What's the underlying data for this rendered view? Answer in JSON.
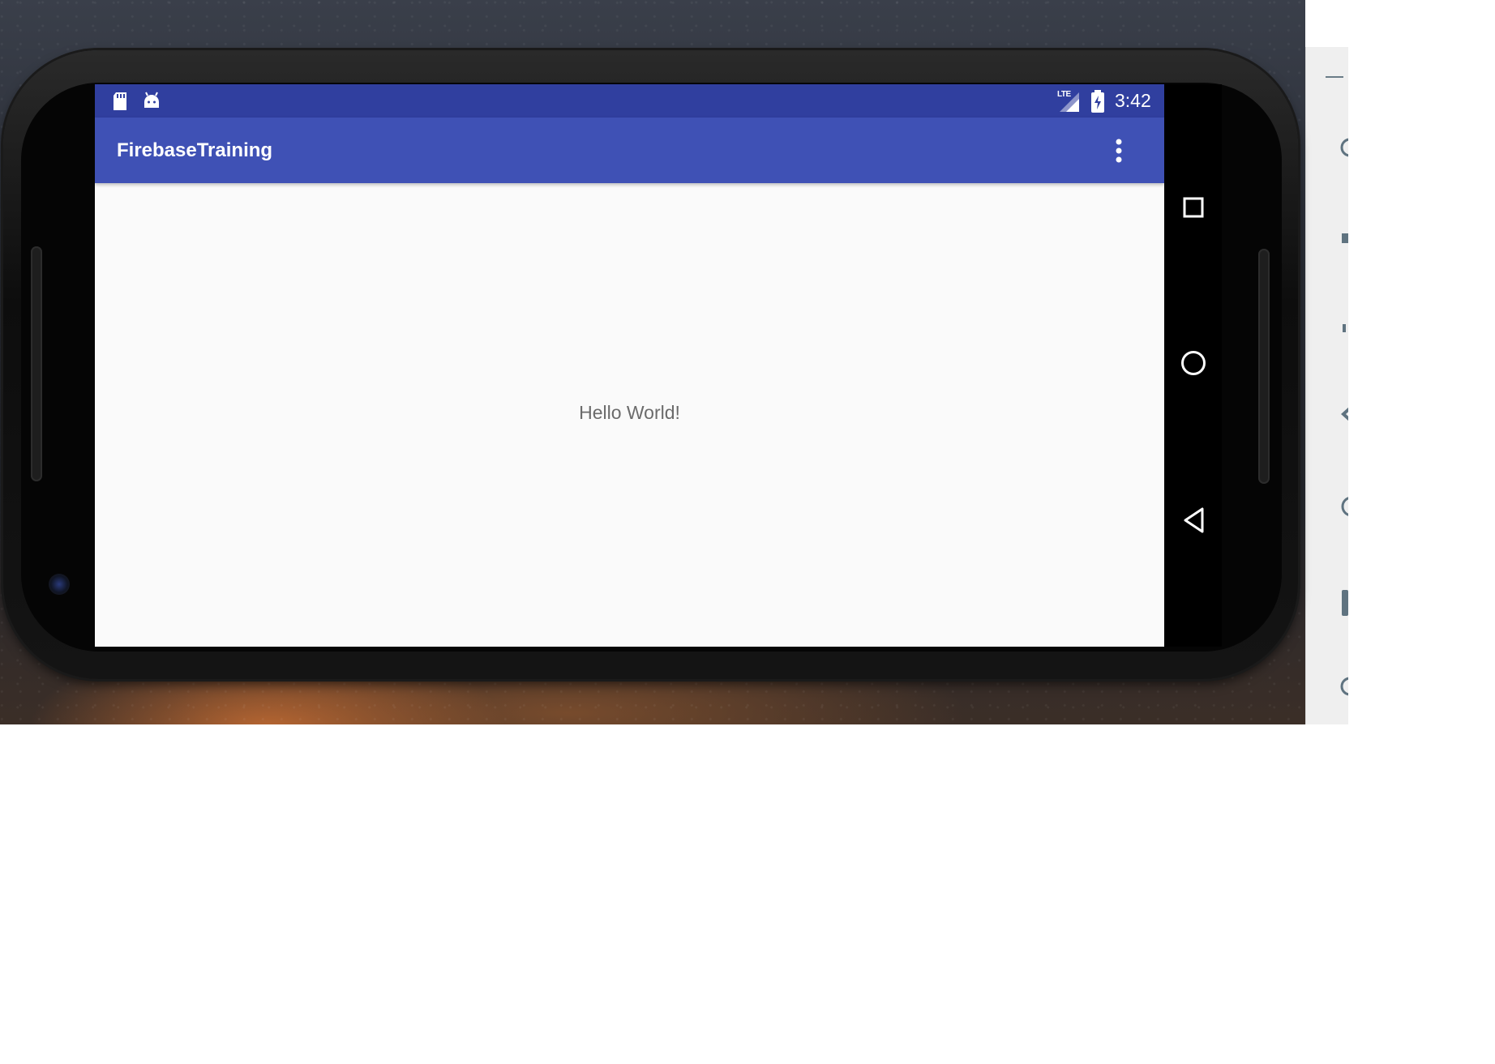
{
  "app": {
    "title": "FirebaseTraining",
    "hello_text": "Hello World!"
  },
  "status_bar": {
    "time": "3:42",
    "network_label": "LTE",
    "icons": [
      "sd-card-icon",
      "android-icon",
      "lte-signal-icon",
      "battery-charging-icon"
    ]
  },
  "navigation_bar": {
    "icons": [
      "recents-icon",
      "home-icon",
      "back-icon"
    ]
  },
  "emulator_toolbar": {
    "icons": [
      "minimize-icon",
      "power-icon",
      "volume-up-icon",
      "volume-down-icon",
      "rotate-left-icon",
      "rotate-right-icon",
      "screenshot-icon",
      "zoom-icon"
    ]
  },
  "colors": {
    "status_bar": "#303f9f",
    "app_bar": "#3f51b5",
    "content_background": "#fafafa",
    "hello_text": "#6b6b6b"
  }
}
